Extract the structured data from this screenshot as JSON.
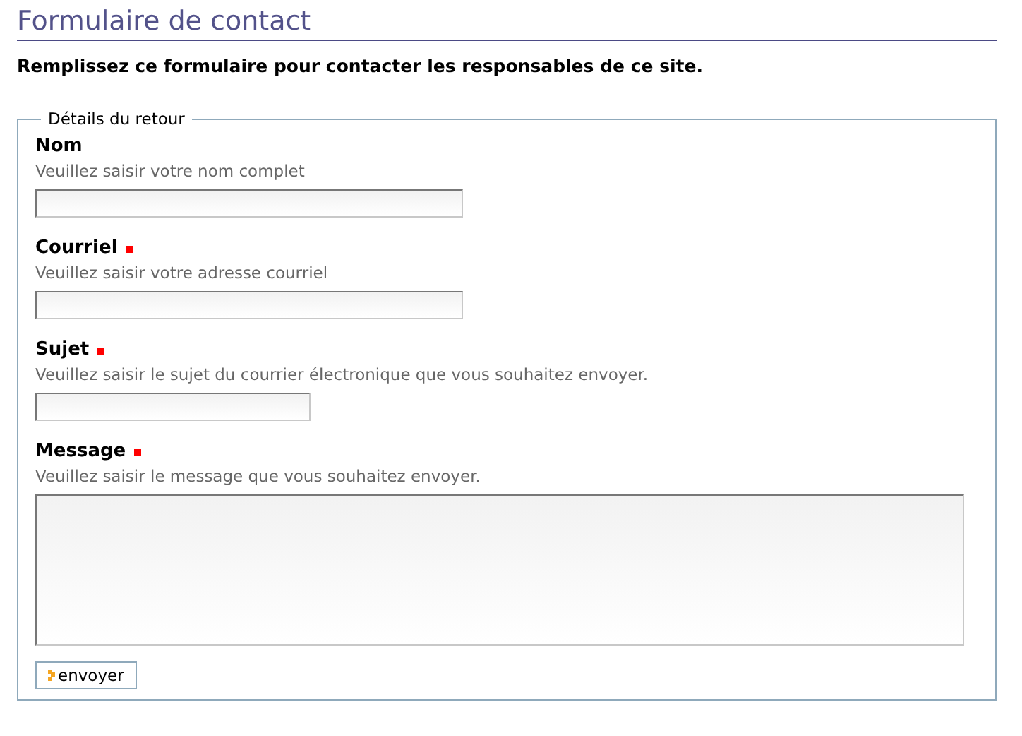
{
  "page": {
    "title": "Formulaire de contact",
    "intro": "Remplissez ce formulaire pour contacter les responsables de ce site."
  },
  "fieldset": {
    "legend": "Détails du retour",
    "fields": [
      {
        "label": "Nom",
        "help": "Veuillez saisir votre nom complet",
        "required": false,
        "kind": "input"
      },
      {
        "label": "Courriel",
        "help": "Veuillez saisir votre adresse courriel",
        "required": true,
        "kind": "input"
      },
      {
        "label": "Sujet",
        "help": "Veuillez saisir le sujet du courrier électronique que vous souhaitez envoyer.",
        "required": true,
        "kind": "short-input"
      },
      {
        "label": "Message",
        "help": "Veuillez saisir le message que vous souhaitez envoyer.",
        "required": true,
        "kind": "textarea"
      }
    ],
    "submit": "envoyer"
  }
}
